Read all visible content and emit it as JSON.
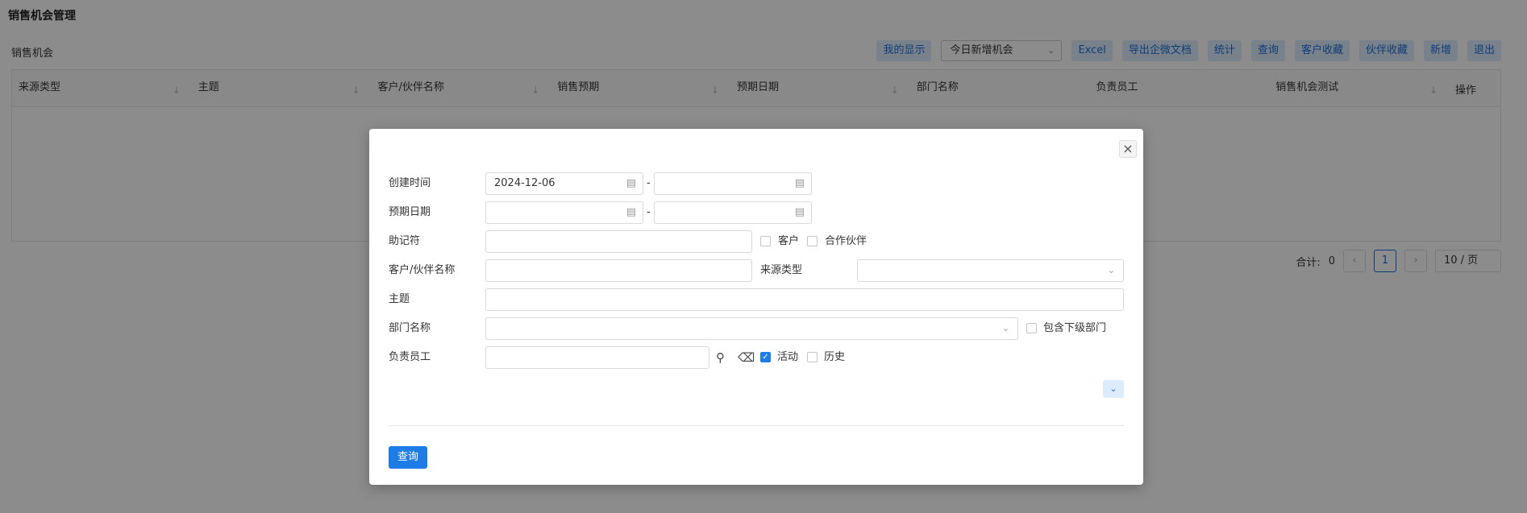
{
  "page": {
    "title": "销售机会管理",
    "panel_label": "销售机会"
  },
  "toolbar": {
    "my_display": "我的显示",
    "filter_select": "今日新增机会",
    "excel": "Excel",
    "export_wechat": "导出企微文档",
    "stats": "统计",
    "query": "查询",
    "customer_fav": "客户收藏",
    "partner_fav": "伙伴收藏",
    "add": "新增",
    "exit": "退出"
  },
  "table": {
    "columns": [
      "来源类型",
      "主题",
      "客户/伙伴名称",
      "销售预期",
      "预期日期",
      "部门名称",
      "负责员工",
      "销售机会测试"
    ],
    "action_column": "操作"
  },
  "pager": {
    "total_label": "合计:",
    "total": "0",
    "current_page": "1",
    "page_size": "10 / 页"
  },
  "dialog": {
    "create_time_label": "创建时间",
    "create_time_start": "2024-12-06",
    "create_time_end": "",
    "expected_date_label": "预期日期",
    "mnemonic_label": "助记符",
    "customer_checkbox": "客户",
    "partner_checkbox": "合作伙伴",
    "name_label": "客户/伙伴名称",
    "source_type_label": "来源类型",
    "subject_label": "主题",
    "dept_label": "部门名称",
    "include_sub_dept": "包含下级部门",
    "staff_label": "负责员工",
    "active_checkbox": "活动",
    "active_checked": true,
    "history_checkbox": "历史",
    "range_separator": "-",
    "query_button": "查询"
  },
  "colors": {
    "accent": "#1e7ce6",
    "light_button": "#dcecfb",
    "overlay": "rgba(0,0,0,0.45)"
  }
}
